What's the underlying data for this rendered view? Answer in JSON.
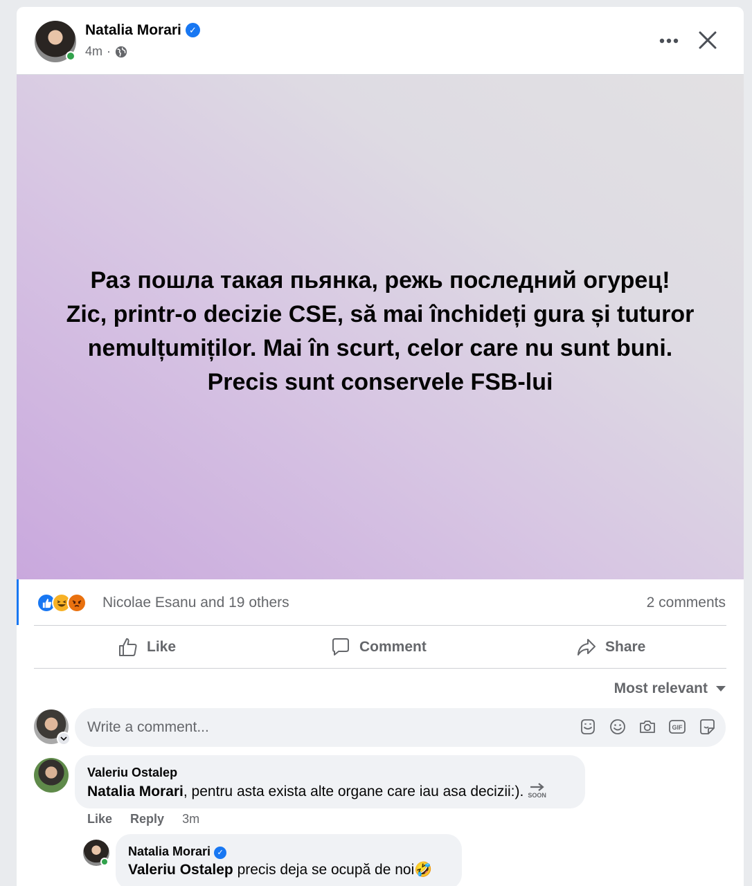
{
  "post": {
    "author": "Natalia Morari",
    "time": "4m",
    "separator": "·",
    "text_lines": [
      "Раз пошла такая пьянка, режь последний огурец!",
      "Zic, printr-o decizie CSE, să mai închideți gura și tuturor",
      "nemulțumiților. Mai în scurt, celor care nu sunt buni.",
      "Precis sunt conservele FSB-lui"
    ],
    "background_colors": [
      "#c9a8dd",
      "#e2e1e3"
    ]
  },
  "reactions": {
    "icons": [
      "like-icon",
      "haha-icon",
      "angry-icon"
    ],
    "summary": "Nicolae Esanu and 19 others",
    "comments_count": "2 comments"
  },
  "actions": {
    "like": "Like",
    "comment": "Comment",
    "share": "Share"
  },
  "sort": {
    "label": "Most relevant"
  },
  "composer": {
    "placeholder": "Write a comment..."
  },
  "comments": [
    {
      "author": "Valeriu Ostalep",
      "mention": "Natalia Morari",
      "text": ", pentru asta exista alte organe care iau asa decizii:).",
      "emoji_label": "SOON",
      "actions": {
        "like": "Like",
        "reply": "Reply",
        "time": "3m"
      }
    },
    {
      "author": "Natalia Morari",
      "mention": "Valeriu Ostalep",
      "text": " precis deja se ocupă de noi",
      "emoji": "🤣"
    }
  ],
  "colors": {
    "accent": "#1877f2",
    "online": "#31a24c",
    "secondary_text": "#65676b"
  }
}
